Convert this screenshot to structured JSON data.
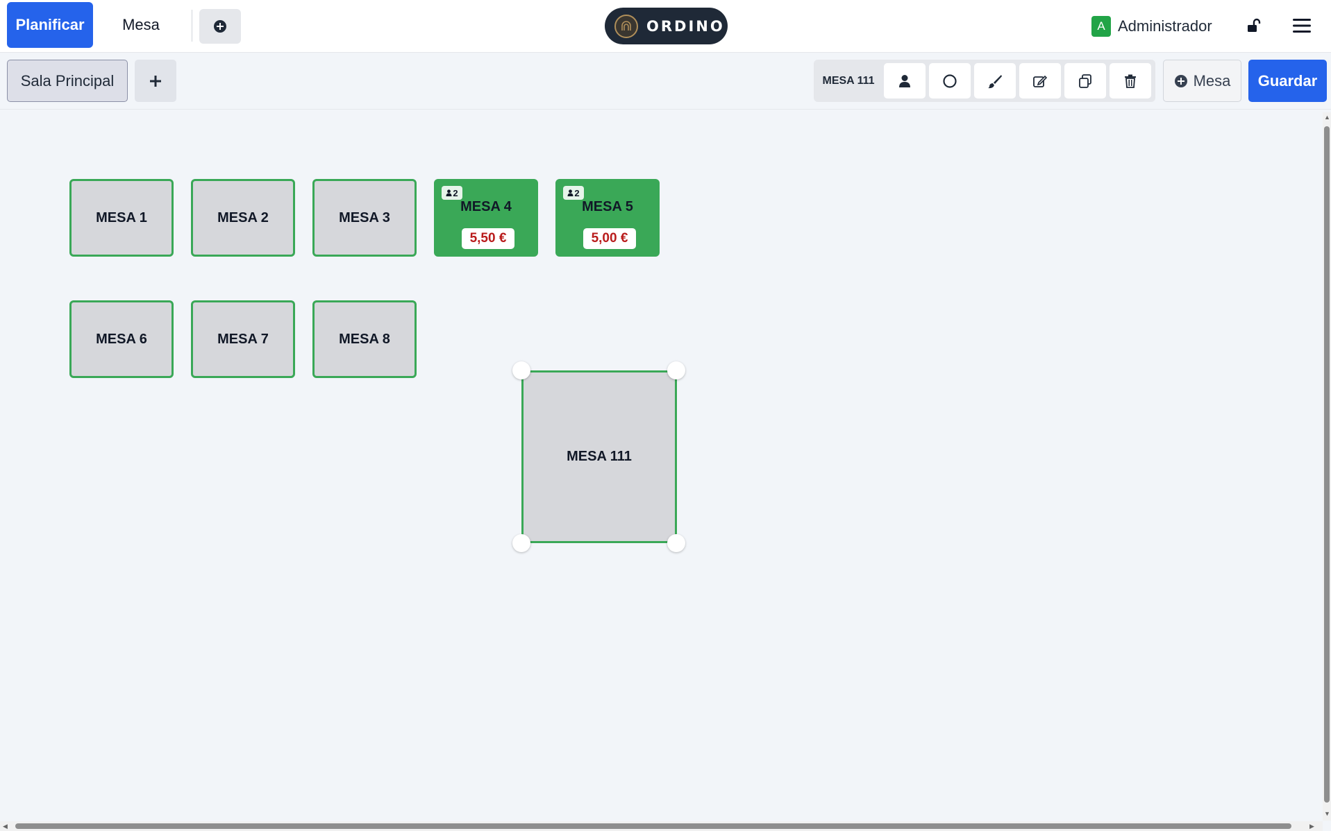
{
  "topbar": {
    "tab_planificar": "Planificar",
    "tab_mesa": "Mesa",
    "logo_text": "ORDINO",
    "avatar_initial": "A",
    "user_name": "Administrador"
  },
  "toolbar": {
    "room_name": "Sala Principal",
    "selected_table": "MESA 111",
    "add_table_label": "Mesa",
    "save_label": "Guardar"
  },
  "tables": [
    {
      "name": "MESA 1",
      "occupied": false
    },
    {
      "name": "MESA 2",
      "occupied": false
    },
    {
      "name": "MESA 3",
      "occupied": false
    },
    {
      "name": "MESA 4",
      "occupied": true,
      "guests": "2",
      "total": "5,50 €"
    },
    {
      "name": "MESA 5",
      "occupied": true,
      "guests": "2",
      "total": "5,00 €"
    },
    {
      "name": "MESA 6",
      "occupied": false
    },
    {
      "name": "MESA 7",
      "occupied": false
    },
    {
      "name": "MESA 8",
      "occupied": false
    },
    {
      "name": "MESA 111",
      "occupied": false,
      "selected": true
    }
  ],
  "colors": {
    "primary": "#2563eb",
    "table_border": "#3aa857",
    "table_free": "#d6d7db",
    "table_occupied": "#3aa857",
    "price": "#b91c1c"
  },
  "icons": [
    "plus-circle-icon",
    "lock-open-icon",
    "hamburger-menu-icon",
    "plus-icon",
    "user-icon",
    "circle-shape-icon",
    "brush-icon",
    "edit-icon",
    "copy-icon",
    "trash-icon"
  ]
}
